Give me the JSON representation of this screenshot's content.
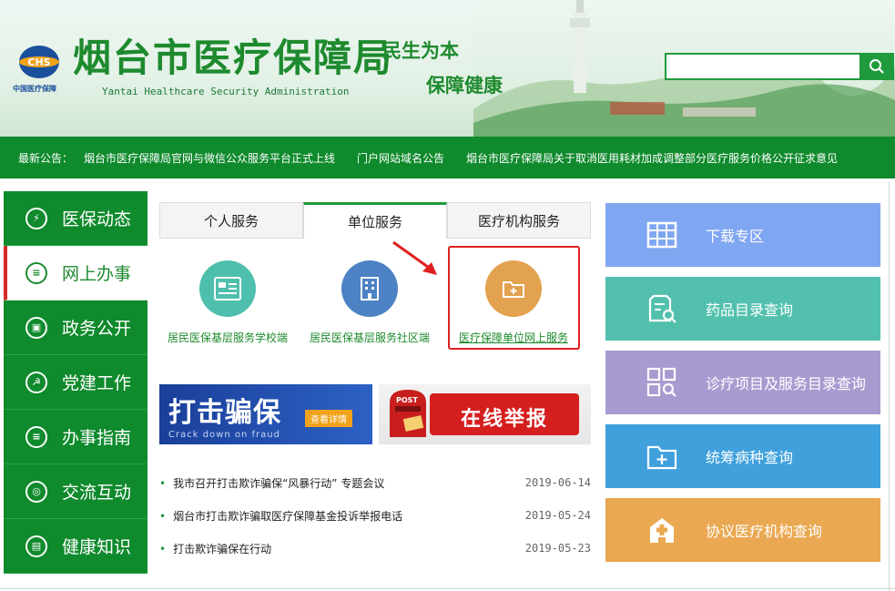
{
  "header": {
    "logo_cn": "中国医疗保障",
    "logo_abbr": "CHS",
    "title": "烟台市医疗保障局",
    "subtitle": "Yantai Healthcare Security Administration",
    "slogan_line1": "民生为本",
    "slogan_line2": "保障健康",
    "search": {
      "value": "",
      "placeholder": ""
    }
  },
  "notice": {
    "label": "最新公告：",
    "items": [
      "烟台市医疗保障局官网与微信公众服务平台正式上线",
      "门户网站域名公告",
      "烟台市医疗保障局关于取消医用耗材加成调整部分医疗服务价格公开征求意见"
    ]
  },
  "nav": {
    "items": [
      {
        "label": "医保动态",
        "icon": "lightning-icon"
      },
      {
        "label": "网上办事",
        "icon": "list-icon"
      },
      {
        "label": "政务公开",
        "icon": "clipboard-icon"
      },
      {
        "label": "党建工作",
        "icon": "hammer-sickle-icon"
      },
      {
        "label": "办事指南",
        "icon": "list-icon"
      },
      {
        "label": "交流互动",
        "icon": "chat-icon"
      },
      {
        "label": "健康知识",
        "icon": "book-icon"
      }
    ],
    "active_index": 1
  },
  "tabs": {
    "items": [
      "个人服务",
      "单位服务",
      "医疗机构服务"
    ],
    "active_index": 1
  },
  "services": [
    {
      "label": "居民医保基层服务学校端",
      "icon": "student-card-icon",
      "color": "#4fbfad"
    },
    {
      "label": "居民医保基层服务社区端",
      "icon": "building-icon",
      "color": "#4d82c4"
    },
    {
      "label": "医疗保障单位网上服务",
      "icon": "folder-plus-icon",
      "color": "#e3a24f"
    }
  ],
  "banners": {
    "fraud": {
      "title": "打击骗保",
      "button": "查看详情",
      "sub": "Crack down on fraud"
    },
    "report": {
      "title": "在线举报",
      "mailbox": "POST"
    }
  },
  "news": [
    {
      "title": "我市召开打击欺诈骗保“风暴行动” 专题会议",
      "date": "2019-06-14"
    },
    {
      "title": "烟台市打击欺诈骗取医疗保障基金投诉举报电话",
      "date": "2019-05-24"
    },
    {
      "title": "打击欺诈骗保在行动",
      "date": "2019-05-23"
    }
  ],
  "quick_links": [
    {
      "label": "下载专区",
      "icon": "grid-table-icon",
      "color": "#7fa6f1"
    },
    {
      "label": "药品目录查询",
      "icon": "document-search-icon",
      "color": "#52c0ad"
    },
    {
      "label": "诊疗项目及服务目录查询",
      "icon": "squares-search-icon",
      "color": "#a99ad0"
    },
    {
      "label": "统筹病种查询",
      "icon": "folder-plus-icon",
      "color": "#3fa0dc"
    },
    {
      "label": "协议医疗机构查询",
      "icon": "hospital-icon",
      "color": "#e9a851"
    }
  ]
}
